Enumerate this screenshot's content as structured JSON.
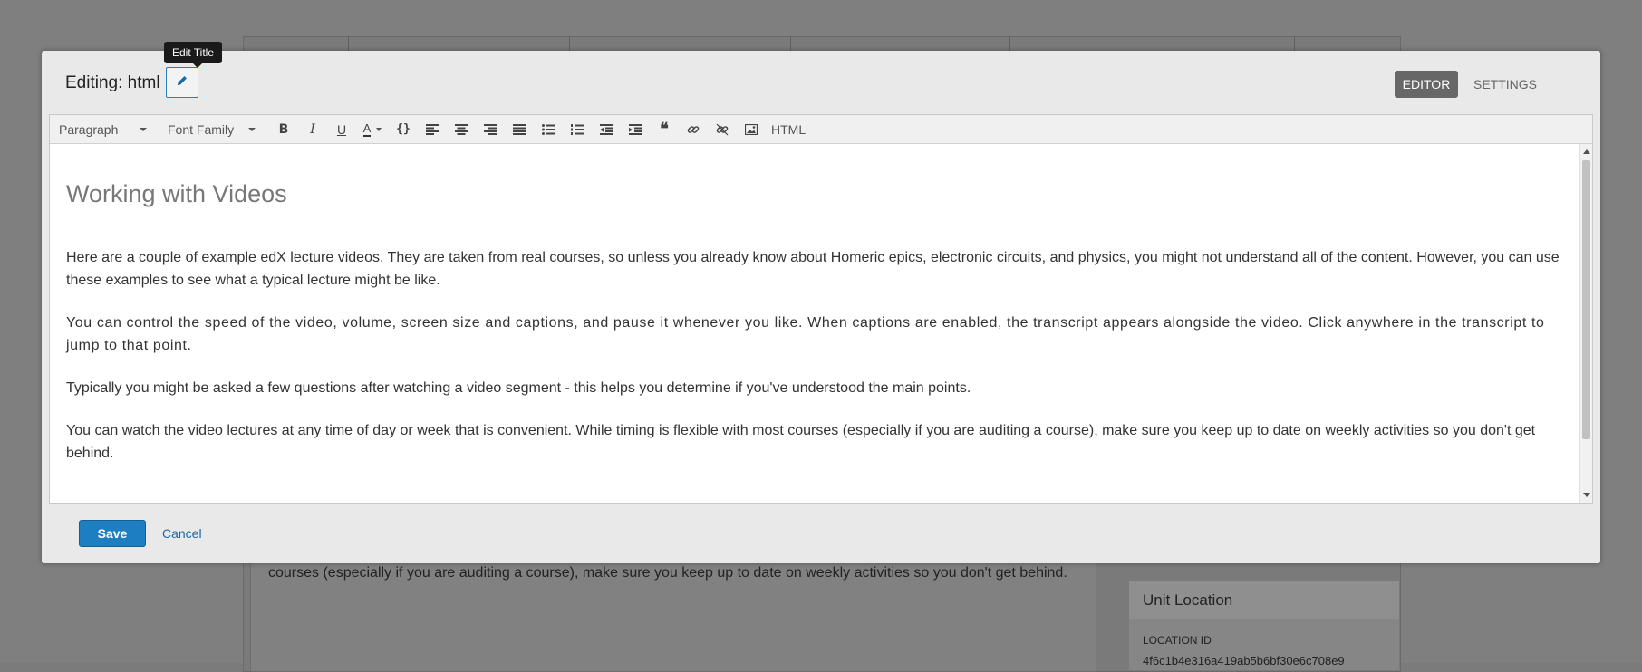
{
  "background": {
    "paragraph": "courses (especially if you are auditing a course), make sure you keep up to date on weekly activities so you don't get behind.",
    "unit_location_title": "Unit Location",
    "location_id_label": "LOCATION ID",
    "location_id_value": "4f6c1b4e316a419ab5b6bf30e6c708e9"
  },
  "modal": {
    "title": "Editing: html",
    "edit_title_tooltip": "Edit Title",
    "modes": {
      "editor": "EDITOR",
      "settings": "SETTINGS"
    },
    "toolbar": {
      "format_select": "Paragraph",
      "font_select": "Font Family",
      "html_button": "HTML",
      "icons": [
        "bold-icon",
        "italic-icon",
        "underline-icon",
        "text-color-icon",
        "code-icon",
        "align-left-icon",
        "align-center-icon",
        "align-right-icon",
        "align-justify-icon",
        "bullet-list-icon",
        "numbered-list-icon",
        "outdent-icon",
        "indent-icon",
        "blockquote-icon",
        "link-icon",
        "unlink-icon",
        "image-icon"
      ]
    },
    "content": {
      "heading": "Working with Videos",
      "paragraphs": [
        "Here are a couple of example edX lecture videos. They are taken from real courses, so unless you already know about Homeric epics, electronic circuits, and physics, you might not understand all of the content. However, you can use these examples to see what a typical lecture might be like.",
        "You can control the speed of the video, volume, screen size and captions, and pause it whenever you like. When captions are enabled, the transcript appears alongside the video. Click anywhere in the transcript to jump to that point.",
        "Typically you might be asked a few questions after watching a video segment - this helps you determine if you've understood the main points.",
        "You can watch the video lectures at any time of day or week that is convenient. While timing is flexible with most courses (especially if you are auditing a course), make sure you keep up to date on weekly activities so you don't get behind."
      ]
    },
    "footer": {
      "save_label": "Save",
      "cancel_label": "Cancel"
    }
  }
}
